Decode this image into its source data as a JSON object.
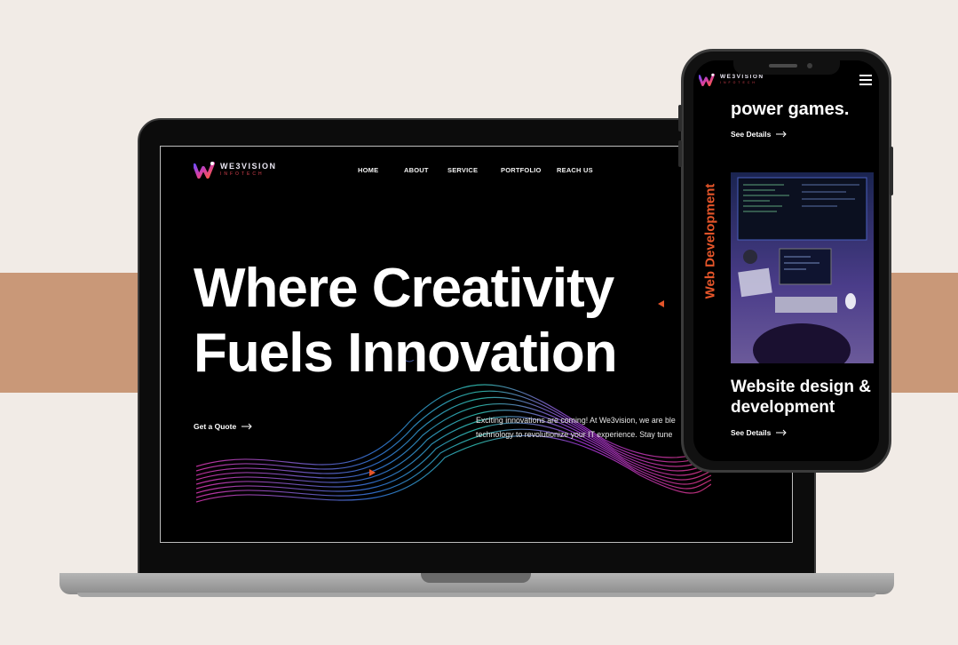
{
  "brand": {
    "name": "WE3VISION",
    "sub": "INFOTECH"
  },
  "laptop": {
    "nav": [
      "HOME",
      "ABOUT",
      "SERVICE",
      "PORTFOLIO",
      "REACH US"
    ],
    "hero_line1": "Where Creativity",
    "hero_line2": "Fuels Innovation",
    "quote_label": "Get a Quote",
    "desc_line1": "Exciting innovations are coming! At We3vision, we are ble",
    "desc_line2": "technology to revolutionize your IT experience. Stay tune"
  },
  "phone": {
    "title1": "power games.",
    "see_details_1": "See Details",
    "vertical_label": "Web Development",
    "title2": "Website design & development",
    "see_details_2": "See Details"
  },
  "colors": {
    "background": "#f1ebe6",
    "band": "#c99878",
    "accent": "#e5552a"
  },
  "icons": [
    "logo-mark-icon",
    "arrow-right-icon",
    "hamburger-menu-icon"
  ]
}
